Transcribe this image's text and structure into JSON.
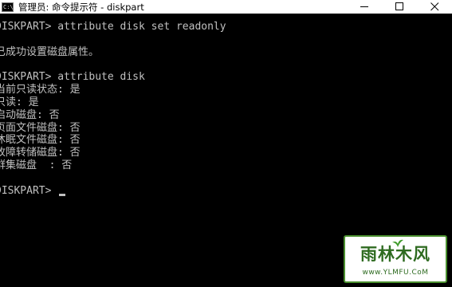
{
  "window": {
    "title": "管理员: 命令提示符 - diskpart",
    "icon_label": "C:\\"
  },
  "console": {
    "lines": [
      "DISKPART> attribute disk set readonly",
      "",
      "已成功设置磁盘属性。",
      "",
      "DISKPART> attribute disk",
      "当前只读状态: 是",
      "只读: 是",
      "启动磁盘: 否",
      "页面文件磁盘: 否",
      "休眠文件磁盘: 否",
      "故障转储磁盘: 否",
      "群集磁盘  : 否",
      "",
      "DISKPART> "
    ]
  },
  "watermark": {
    "brand": "雨林木风",
    "url": "www.YLMFU.CoM"
  },
  "colors": {
    "console_bg": "#000000",
    "console_text": "#c0c0c0",
    "watermark_green": "#2e6b20"
  }
}
